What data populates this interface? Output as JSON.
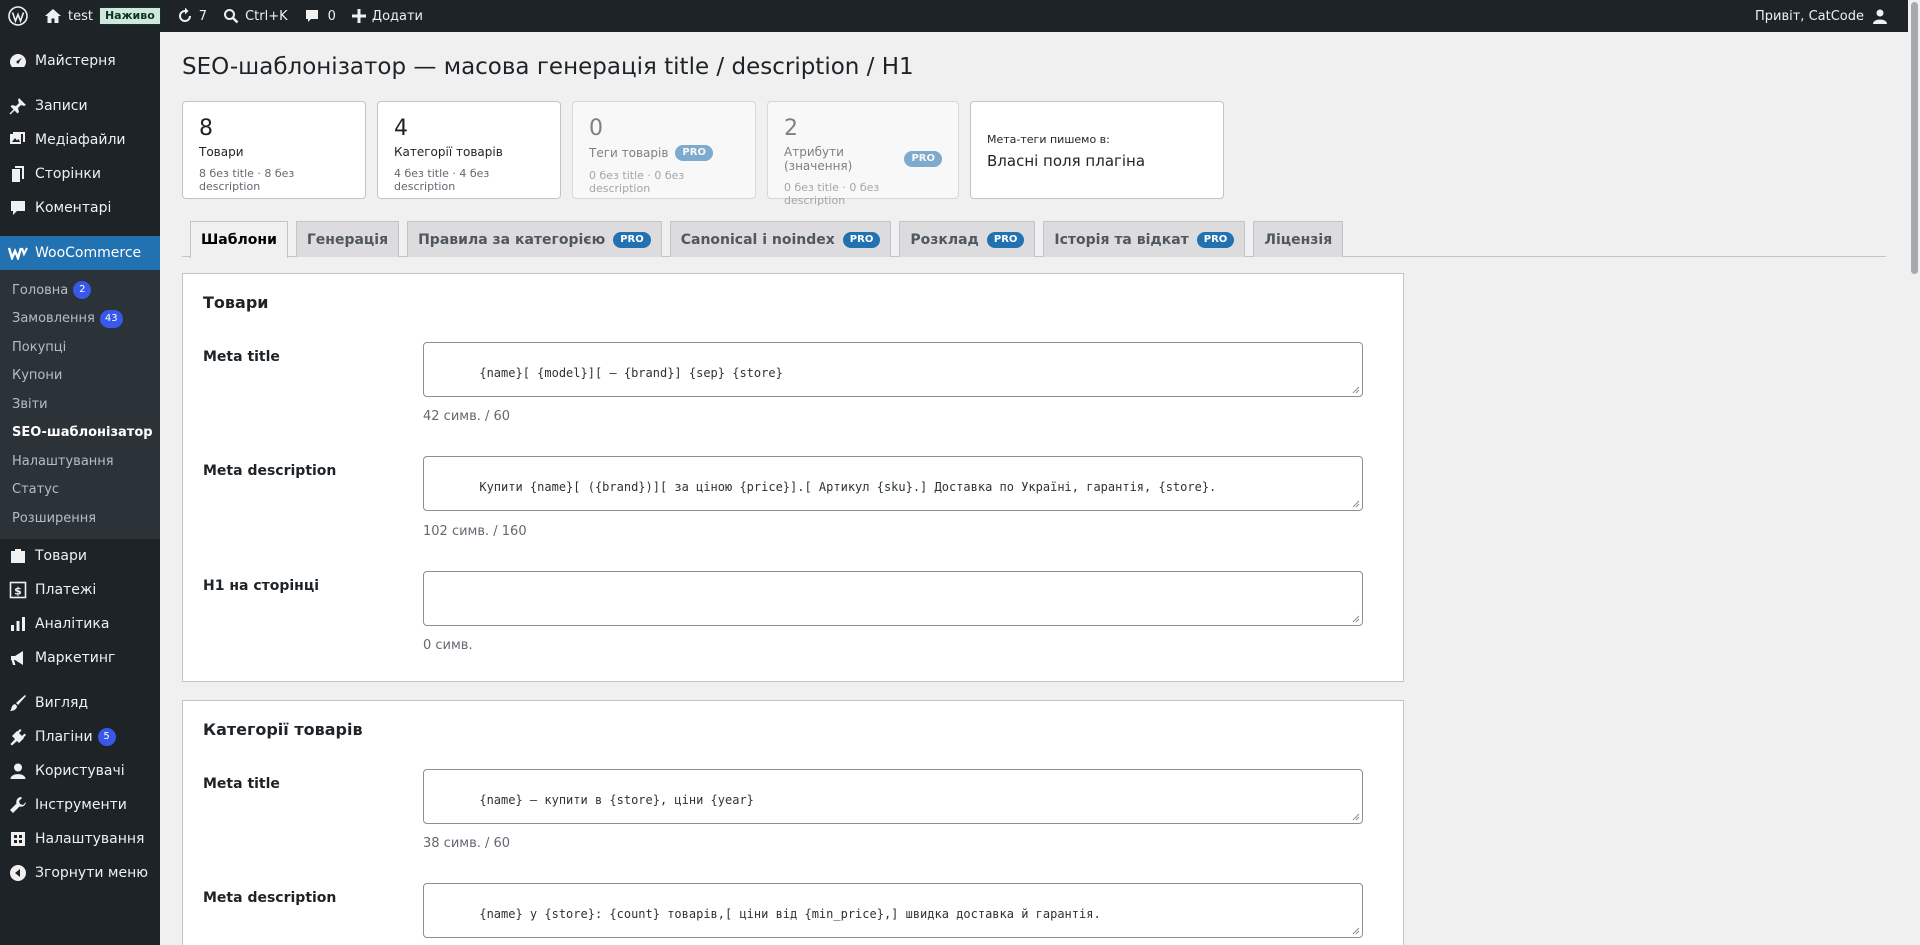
{
  "adminbar": {
    "site_name": "test",
    "live_label": "Наживо",
    "updates_count": "7",
    "search_shortcut": "Ctrl+K",
    "comments_count": "0",
    "new_label": "Додати",
    "greeting": "Привіт, CatCode"
  },
  "sidebar": {
    "top_items": [
      {
        "label": "Майстерня",
        "icon": "gauge-icon"
      },
      {
        "label": "Записи",
        "icon": "pin-icon"
      },
      {
        "label": "Медіафайли",
        "icon": "media-icon"
      },
      {
        "label": "Сторінки",
        "icon": "page-icon"
      },
      {
        "label": "Коментарі",
        "icon": "comment-icon"
      }
    ],
    "woocommerce": {
      "label": "WooCommerce",
      "icon": "woo-icon"
    },
    "sub_items": [
      {
        "label": "Головна",
        "badge": "2"
      },
      {
        "label": "Замовлення",
        "badge": "43"
      },
      {
        "label": "Покупці"
      },
      {
        "label": "Купони"
      },
      {
        "label": "Звіти"
      },
      {
        "label": "SEO-шаблонізатор"
      },
      {
        "label": "Налаштування"
      },
      {
        "label": "Статус"
      },
      {
        "label": "Розширення"
      }
    ],
    "bottom_items": [
      {
        "label": "Товари",
        "icon": "box-icon"
      },
      {
        "label": "Платежі",
        "icon": "dollar-icon"
      },
      {
        "label": "Аналітика",
        "icon": "bar-chart-icon"
      },
      {
        "label": "Маркетинг",
        "icon": "megaphone-icon"
      },
      {
        "label": "Вигляд",
        "icon": "brush-icon"
      },
      {
        "label": "Плагіни",
        "icon": "plug-icon",
        "badge": "5"
      },
      {
        "label": "Користувачі",
        "icon": "user-icon"
      },
      {
        "label": "Інструменти",
        "icon": "wrench-icon"
      },
      {
        "label": "Налаштування",
        "icon": "settings-icon"
      },
      {
        "label": "Згорнути меню",
        "icon": "collapse-icon"
      }
    ]
  },
  "page": {
    "title": "SEO-шаблонізатор — масова генерація title / description / H1"
  },
  "stats": [
    {
      "num": "8",
      "label": "Товари",
      "sub": "8 без title · 8 без description"
    },
    {
      "num": "4",
      "label": "Категорії товарів",
      "sub": "4 без title · 4 без description"
    },
    {
      "num": "0",
      "label": "Теги товарів",
      "sub": "0 без title · 0 без description",
      "pro": "PRO"
    },
    {
      "num": "2",
      "label": "Атрибути (значення)",
      "sub": "0 без title · 0 без description",
      "pro": "PRO"
    }
  ],
  "meta_card": {
    "note": "Мета-теги пишемо в:",
    "value": "Власні поля плагіна"
  },
  "tabs": [
    {
      "label": "Шаблони"
    },
    {
      "label": "Генерація"
    },
    {
      "label": "Правила за категорією",
      "pro": "PRO"
    },
    {
      "label": "Canonical і noindex",
      "pro": "PRO"
    },
    {
      "label": "Розклад",
      "pro": "PRO"
    },
    {
      "label": "Історія та відкат",
      "pro": "PRO"
    },
    {
      "label": "Ліцензія"
    }
  ],
  "panels": {
    "products": {
      "title": "Товари",
      "fields": [
        {
          "label": "Meta title",
          "value": "{name}[ {model}][ — {brand}] {sep} {store}",
          "count": "42 симв. / 60"
        },
        {
          "label": "Meta description",
          "value": "Купити {name}[ ({brand})][ за ціною {price}].[ Артикул {sku}.] Доставка по Україні, гарантія, {store}.",
          "count": "102 симв. / 160"
        },
        {
          "label": "H1 на сторінці",
          "value": "",
          "count": "0 симв."
        }
      ]
    },
    "categories": {
      "title": "Категорії товарів",
      "fields": [
        {
          "label": "Meta title",
          "value": "{name} — купити в {store}, ціни {year}",
          "count": "38 симв. / 60"
        },
        {
          "label": "Meta description",
          "value": "{name} у {store}: {count} товарів,[ ціни від {min_price},] швидка доставка й гарантія."
        }
      ]
    }
  }
}
